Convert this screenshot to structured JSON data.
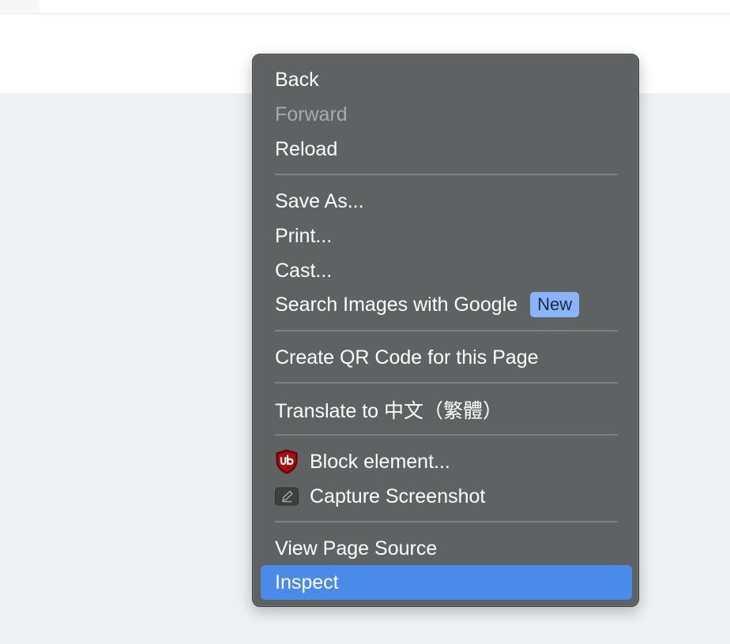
{
  "menu": {
    "back": "Back",
    "forward": "Forward",
    "reload": "Reload",
    "save_as": "Save As...",
    "print": "Print...",
    "cast": "Cast...",
    "search_images": "Search Images with Google",
    "search_images_badge": "New",
    "create_qr": "Create QR Code for this Page",
    "translate": "Translate to 中文（繁體）",
    "block_element": "Block element...",
    "capture_screenshot": "Capture Screenshot",
    "view_source": "View Page Source",
    "inspect": "Inspect"
  },
  "icons": {
    "block_element": "ublock-origin-shield-icon",
    "capture_screenshot": "screenshot-pencil-icon"
  },
  "colors": {
    "menu_background": "#5f6262",
    "highlight": "#4a8ae8",
    "badge": "#8ab4f8",
    "disabled_text": "#a9abab",
    "page_background": "#eef0f4"
  }
}
